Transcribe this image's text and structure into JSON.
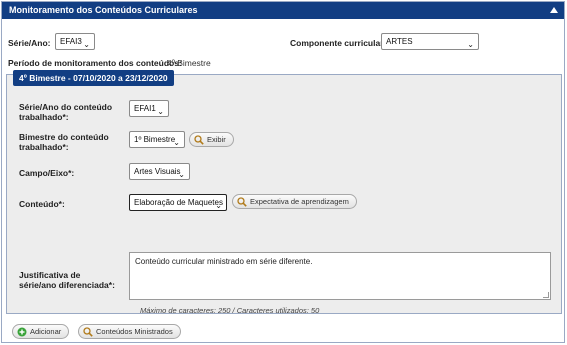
{
  "header": {
    "title": "Monitoramento dos Conteúdos Curriculares"
  },
  "top": {
    "serie_label": "Série/Ano:",
    "serie_value": "EFAI3",
    "componente_label": "Componente curricular:",
    "componente_value": "ARTES",
    "periodo_label": "Período de monitoramento dos conteúdos:",
    "periodo_value": "4º Bimestre"
  },
  "section": {
    "legend": "4º Bimestre - 07/10/2020 a 23/12/2020",
    "serie_conteudo_label": "Série/Ano do conteúdo trabalhado*:",
    "serie_conteudo_value": "EFAI1",
    "bimestre_label": "Bimestre do conteúdo trabalhado*:",
    "bimestre_value": "1º Bimestre",
    "exibir_label": "Exibir",
    "campo_label": "Campo/Eixo*:",
    "campo_value": "Artes Visuais",
    "conteudo_label": "Conteúdo*:",
    "conteudo_value": "Elaboração de Maquetes",
    "expectativa_label": "Expectativa de aprendizagem",
    "justificativa_label": "Justificativa de série/ano diferenciada*:",
    "justificativa_value": "Conteúdo curricular ministrado em série diferente.",
    "hint": "Máximo de caracteres: 250 / Caracteres utilizados: 50"
  },
  "actions": {
    "adicionar_label": "Adicionar",
    "conteudos_label": "Conteúdos Ministrados"
  },
  "colors": {
    "header_bg": "#123e83",
    "fieldset_bg": "#ededed",
    "add_icon": "#3aa33a"
  }
}
